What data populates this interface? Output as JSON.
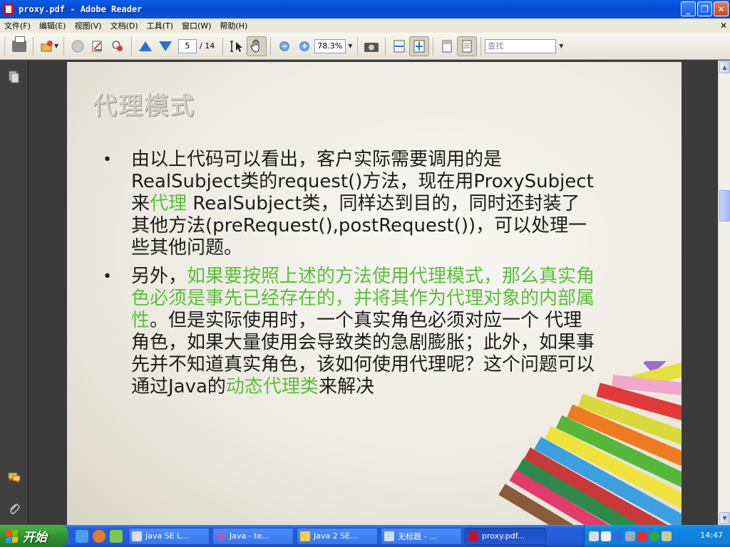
{
  "window": {
    "title": "proxy.pdf - Adobe Reader"
  },
  "menu": [
    "文件(F)",
    "编辑(E)",
    "视图(V)",
    "文档(D)",
    "工具(T)",
    "窗口(W)",
    "帮助(H)"
  ],
  "toolbar": {
    "page_current": "5",
    "page_total": "/ 14",
    "zoom": "78.3%",
    "find_placeholder": "查找"
  },
  "slide": {
    "title": "代理模式",
    "bullet1": [
      {
        "t": "由以上代码可以看出，客户实际需要调用的是"
      },
      {
        "br": true
      },
      {
        "t": "RealSubject类的request()方法，现在用ProxySubject"
      },
      {
        "br": true
      },
      {
        "t": "来"
      },
      {
        "t": "代理",
        "g": true
      },
      {
        "t": " RealSubject类，同样达到目的，同时还封装了"
      },
      {
        "br": true
      },
      {
        "t": "其他方法(preRequest(),postRequest())，可以处理一"
      },
      {
        "br": true
      },
      {
        "t": "些其他问题。"
      }
    ],
    "bullet2": [
      {
        "t": "另外，"
      },
      {
        "t": "如果要按照上述的方法使用代理模式，那么真实角",
        "g": true
      },
      {
        "br": true
      },
      {
        "t": "色必须是事先已经存在的，并将其作为代理对象的内部属",
        "g": true
      },
      {
        "br": true
      },
      {
        "t": "性",
        "g": true
      },
      {
        "t": "。但是实际使用时，一个真实角色必须对应一个 代理"
      },
      {
        "br": true
      },
      {
        "t": "角色，如果大量使用会导致类的急剧膨胀；此外，如果事"
      },
      {
        "br": true
      },
      {
        "t": "先并不知道真实角色，该如何使用代理呢？这个问题可以"
      },
      {
        "br": true
      },
      {
        "t": "通过Java的"
      },
      {
        "t": "动态代理类",
        "g": true
      },
      {
        "t": "来解决"
      }
    ]
  },
  "taskbar": {
    "start": "开始",
    "tasks": [
      "Java SE L...",
      "Java - te...",
      "Java 2 SE...",
      "无标题 - ...",
      "proxy.pdf..."
    ],
    "clock": "14:47"
  },
  "colors": {
    "accent_green": "#5bbf3a",
    "title_blue": "#0349d0"
  }
}
